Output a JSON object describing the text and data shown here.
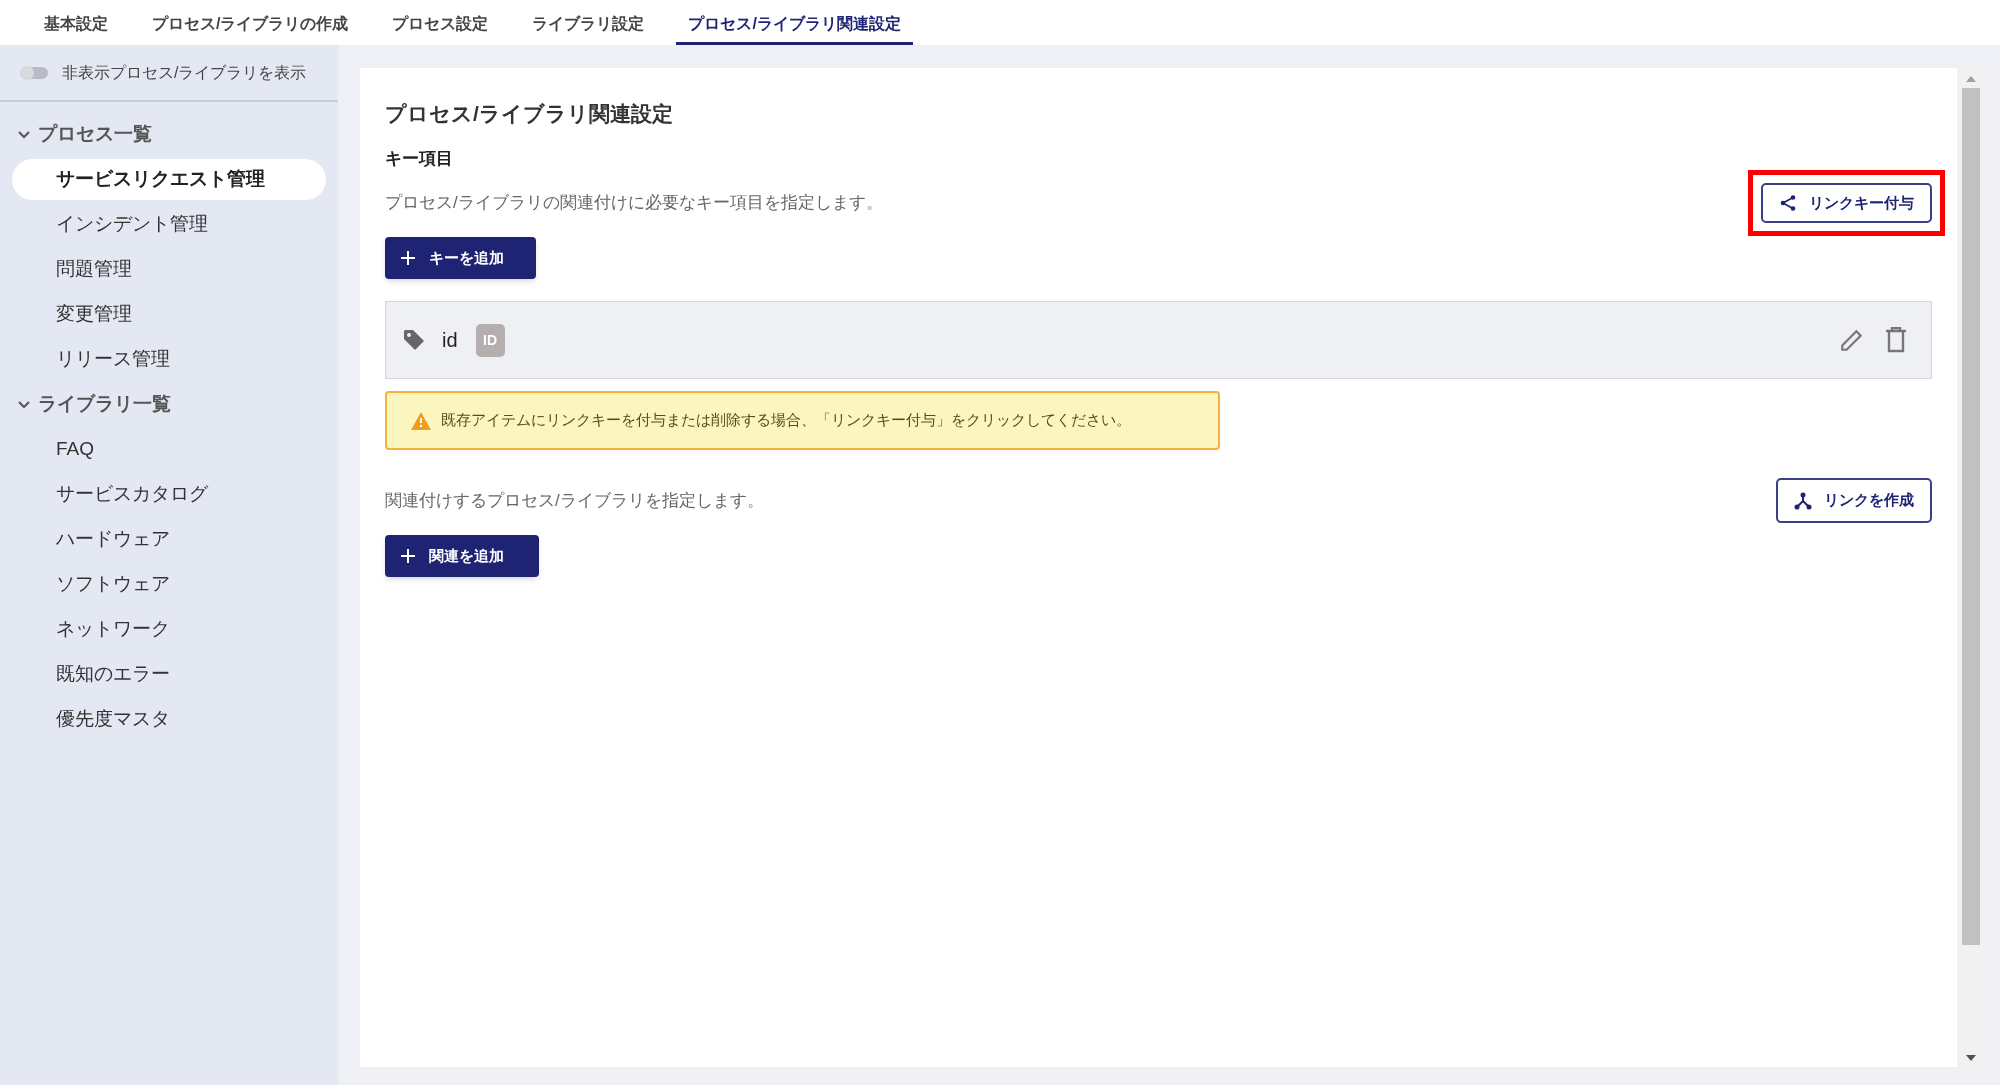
{
  "tabs": [
    {
      "label": "基本設定",
      "selected": false
    },
    {
      "label": "プロセス/ライブラリの作成",
      "selected": false
    },
    {
      "label": "プロセス設定",
      "selected": false
    },
    {
      "label": "ライブラリ設定",
      "selected": false
    },
    {
      "label": "プロセス/ライブラリ関連設定",
      "selected": true
    }
  ],
  "sidebar": {
    "toggle": {
      "label": "非表示プロセス/ライブラリを表示",
      "on": false
    },
    "groups": [
      {
        "label": "プロセス一覧",
        "expanded": true,
        "items": [
          {
            "label": "サービスリクエスト管理",
            "selected": true
          },
          {
            "label": "インシデント管理",
            "selected": false
          },
          {
            "label": "問題管理",
            "selected": false
          },
          {
            "label": "変更管理",
            "selected": false
          },
          {
            "label": "リリース管理",
            "selected": false
          }
        ]
      },
      {
        "label": "ライブラリ一覧",
        "expanded": true,
        "items": [
          {
            "label": "FAQ",
            "selected": false
          },
          {
            "label": "サービスカタログ",
            "selected": false
          },
          {
            "label": "ハードウェア",
            "selected": false
          },
          {
            "label": "ソフトウェア",
            "selected": false
          },
          {
            "label": "ネットワーク",
            "selected": false
          },
          {
            "label": "既知のエラー",
            "selected": false
          },
          {
            "label": "優先度マスタ",
            "selected": false
          }
        ]
      }
    ]
  },
  "main": {
    "title": "プロセス/ライブラリ関連設定",
    "key_section": {
      "heading": "キー項目",
      "description": "プロセス/ライブラリの関連付けに必要なキー項目を指定します。",
      "link_key_button": {
        "label": "リンクキー付与",
        "highlighted": true
      },
      "add_button": "キーを追加",
      "keys": [
        {
          "name": "id",
          "badge": "ID"
        }
      ],
      "warning": "既存アイテムにリンクキーを付与または削除する場合、「リンクキー付与」をクリックしてください。"
    },
    "relation_section": {
      "description": "関連付けするプロセス/ライブラリを指定します。",
      "create_link_button": "リンクを作成",
      "add_button": "関連を追加"
    }
  }
}
